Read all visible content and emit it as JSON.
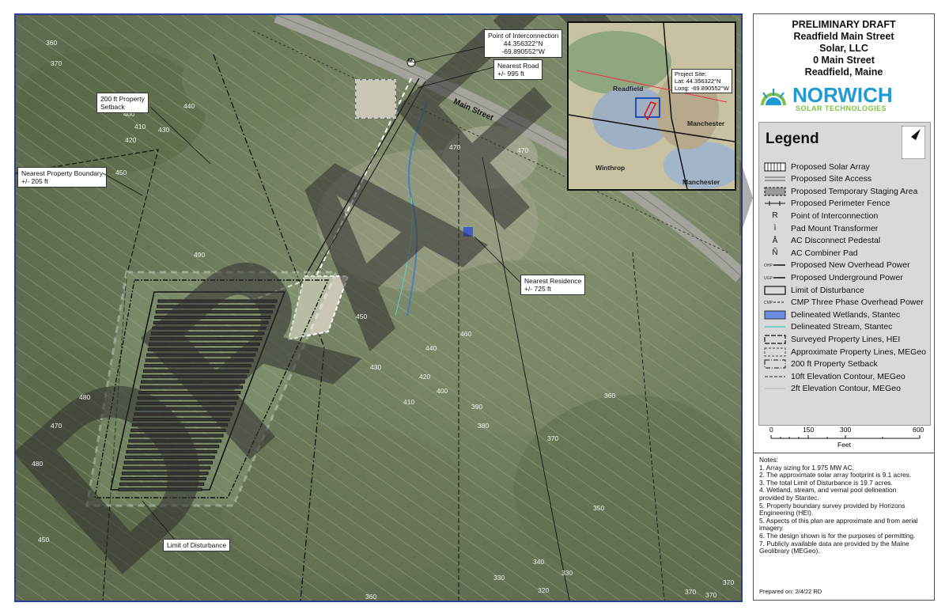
{
  "map": {
    "watermark": "DRAFT",
    "road_label": "Main Street",
    "callouts": {
      "poi_title": "Point of Interconnection",
      "poi_lat": "44.356322°N",
      "poi_long": "-69.890552°W",
      "nearest_road": "Nearest Road",
      "nearest_road_dist": "+/- 995 ft",
      "setback": "200 ft Property",
      "setback2": "Setback",
      "boundary": "Nearest Property Boundary",
      "boundary_dist": "+/- 205 ft",
      "residence": "Nearest Residence",
      "residence_dist": "+/- 725 ft",
      "lod": "Limit of Disturbance",
      "poi_marker": "M"
    },
    "contours": [
      "360",
      "370",
      "440",
      "400",
      "410",
      "430",
      "420",
      "450",
      "490",
      "480",
      "470",
      "480",
      "450",
      "470",
      "470",
      "450",
      "440",
      "430",
      "420",
      "400",
      "410",
      "390",
      "380",
      "360",
      "370",
      "350",
      "340",
      "330",
      "330",
      "320",
      "360",
      "370",
      "370",
      "370",
      "460"
    ],
    "inset": {
      "towns": [
        "Readfield",
        "Manchester",
        "Winthrop",
        "Manchester"
      ],
      "callout_title": "Project Site:",
      "callout_lat": "Lat: 44.356322°N",
      "callout_long": "Long: -69.890552°W"
    }
  },
  "panel": {
    "title_lines": [
      "PRELIMINARY DRAFT",
      "Readfield Main Street",
      "Solar, LLC",
      "0 Main Street",
      "Readfield, Maine"
    ],
    "logo_main": "NORWICH",
    "logo_sub": "SOLAR TECHNOLOGIES",
    "legend_title": "Legend",
    "legend_items": [
      {
        "sym": "array",
        "label": "Proposed Solar Array"
      },
      {
        "sym": "access",
        "label": "Proposed Site Access"
      },
      {
        "sym": "staging",
        "label": "Proposed Temporary Staging Area"
      },
      {
        "sym": "fence",
        "label": "Proposed Perimeter Fence"
      },
      {
        "sym": "R",
        "label": "Point of Interconnection"
      },
      {
        "sym": "ì",
        "label": "Pad Mount Transformer"
      },
      {
        "sym": "Å",
        "label": "AC Disconnect Pedestal"
      },
      {
        "sym": "Ñ",
        "label": "AC Combiner Pad"
      },
      {
        "sym": "ohp",
        "label": "Proposed New Overhead Power"
      },
      {
        "sym": "ugp",
        "label": "Proposed Underground Power"
      },
      {
        "sym": "lod",
        "label": "Limit of Disturbance"
      },
      {
        "sym": "cmp",
        "label": "CMP Three Phase Overhead Power"
      },
      {
        "sym": "wet",
        "label": "Delineated Wetlands, Stantec"
      },
      {
        "sym": "stream",
        "label": "Delineated Stream, Stantec"
      },
      {
        "sym": "surv",
        "label": "Surveyed Property Lines, HEI"
      },
      {
        "sym": "approx",
        "label": "Approximate Property Lines, MEGeo"
      },
      {
        "sym": "setb",
        "label": "200 ft Property Setback"
      },
      {
        "sym": "c10",
        "label": "10ft Elevation Contour, MEGeo"
      },
      {
        "sym": "c2",
        "label": "2ft Elevation Contour, MEGeo"
      }
    ],
    "ohp_tag": "OHP",
    "ugp_tag": "UGP",
    "cmp_tag": "CMP",
    "scale": {
      "ticks": [
        "0",
        "150",
        "300",
        "600"
      ],
      "unit": "Feet"
    },
    "notes_title": "Notes:",
    "notes": [
      "1. Array sizing for 1.975 MW AC.",
      "2. The approximate solar array footprint is 9.1 acres.",
      "3. The total Limit of Disturbance is 19.7 acres.",
      "4. Wetland, stream, and vernal pool delineation",
      "provided by Stantec.",
      "5. Property boundary survey provided by Horizons",
      "Engineering (HEI).",
      "5. Aspects of this plan are approximate and from aerial",
      "imagery.",
      "6. The design shown is for the purposes of permitting.",
      "7. Publicly available data are provided by the Maine",
      "Geolibrary (MEGeo)."
    ],
    "prepared": "Prepared on: 2/4/22 RD"
  }
}
